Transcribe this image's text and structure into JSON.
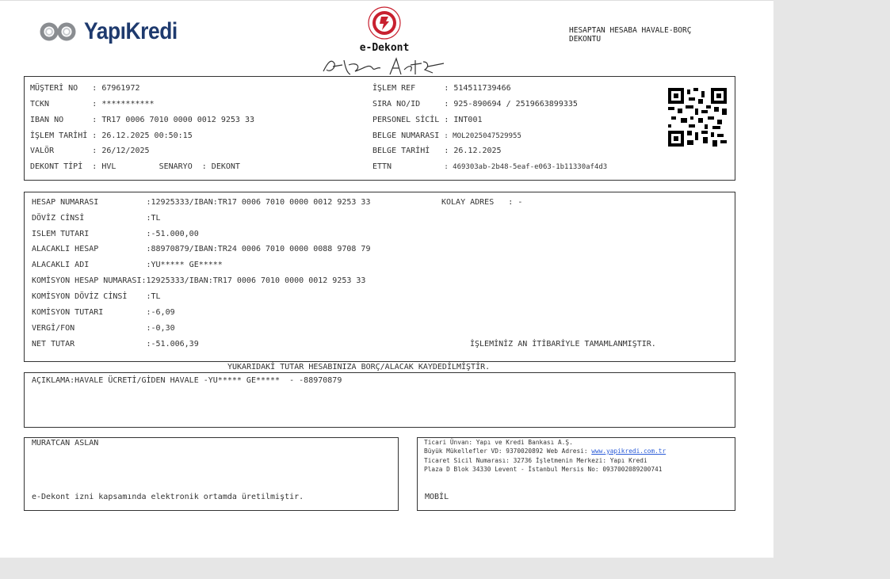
{
  "header": {
    "bank_name": "YapıKredi",
    "center_title": "e-Dekont",
    "document_title": "HESAPTAN HESABA HAVALE-BORÇ DEKONTU"
  },
  "top_info": {
    "left": [
      {
        "label": "MÜŞTERİ NO  ",
        "value": ": 67961972"
      },
      {
        "label": "TCKN        ",
        "value": ": ***********"
      },
      {
        "label": "IBAN NO     ",
        "value": ": TR17 0006 7010 0000 0012 9253 33"
      },
      {
        "label": "İŞLEM TARİHİ",
        "value": ": 26.12.2025 00:50:15"
      },
      {
        "label": "VALÖR       ",
        "value": ": 26/12/2025"
      },
      {
        "label": "DEKONT TİPİ ",
        "value": ": HVL         SENARYO  : DEKONT"
      }
    ],
    "right": [
      {
        "label": "İŞLEM REF     ",
        "value": ": 514511739466"
      },
      {
        "label": "SIRA NO/ID    ",
        "value": ": 925-890694 / 2519663899335"
      },
      {
        "label": "PERSONEL SİCİL",
        "value": ": INT001"
      },
      {
        "label": "BELGE NUMARASI",
        "value": ": MOL2025047529955"
      },
      {
        "label": "BELGE TARİHİ  ",
        "value": ": 26.12.2025"
      },
      {
        "label": "ETTN          ",
        "value": ": 469303ab-2b48-5eaf-e063-1b11330af4d3"
      }
    ]
  },
  "details": {
    "rows": [
      {
        "label": "HESAP NUMARASI          ",
        "value": ":12925333/IBAN:TR17 0006 7010 0000 0012 9253 33"
      },
      {
        "label": "DÖVİZ CİNSİ             ",
        "value": ":TL"
      },
      {
        "label": "ISLEM TUTARI            ",
        "value": ":-51.000,00"
      },
      {
        "label": "ALACAKLI HESAP          ",
        "value": ":88970879/IBAN:TR24 0006 7010 0000 0088 9708 79"
      },
      {
        "label": "ALACAKLI ADI            ",
        "value": ":YU***** GE*****"
      },
      {
        "label": "KOMİSYON HESAP NUMARASI",
        "value": ":12925333/IBAN:TR17 0006 7010 0000 0012 9253 33"
      },
      {
        "label": "KOMİSYON DÖVİZ CİNSİ    ",
        "value": ":TL"
      },
      {
        "label": "KOMİSYON TUTARI         ",
        "value": ":-6,09"
      },
      {
        "label": "VERGİ/FON               ",
        "value": ":-0,30"
      },
      {
        "label": "NET TUTAR               ",
        "value": ":-51.006,39"
      }
    ],
    "kolay_adres": "KOLAY ADRES   : -",
    "completion_note": "İŞLEMİNİZ AN İTİBARİYLE TAMAMLANMIŞTIR."
  },
  "notice": "YUKARIDAKİ TUTAR HESABINIZA BORÇ/ALACAK KAYDEDİLMİŞTİR.",
  "description": "AÇIKLAMA:HAVALE ÜCRETİ/GİDEN HAVALE -YU***** GE*****  - -88970879",
  "footer_left": {
    "name": "MURATCAN ASLAN",
    "note": "e-Dekont izni kapsamında elektronik ortamda üretilmiştir."
  },
  "footer_right": {
    "line1": "Ticari Ünvan: Yapı ve Kredi Bankası A.Ş.",
    "line2_prefix": "Büyük Mükellefler VD: 9370020892 Web Adresi: ",
    "web": "www.yapikredi.com.tr",
    "line3": "Ticaret Sicil Numarası: 32736 İşletmenin Merkezi: Yapı Kredi",
    "line4": "Plaza D Blok 34330 Levent - İstanbul Mersis No: 0937002089200741",
    "channel": "MOBİL"
  },
  "colors": {
    "brand_blue": "#1e3a6e",
    "seal_red": "#c8202f",
    "link": "#2a5bd7"
  }
}
